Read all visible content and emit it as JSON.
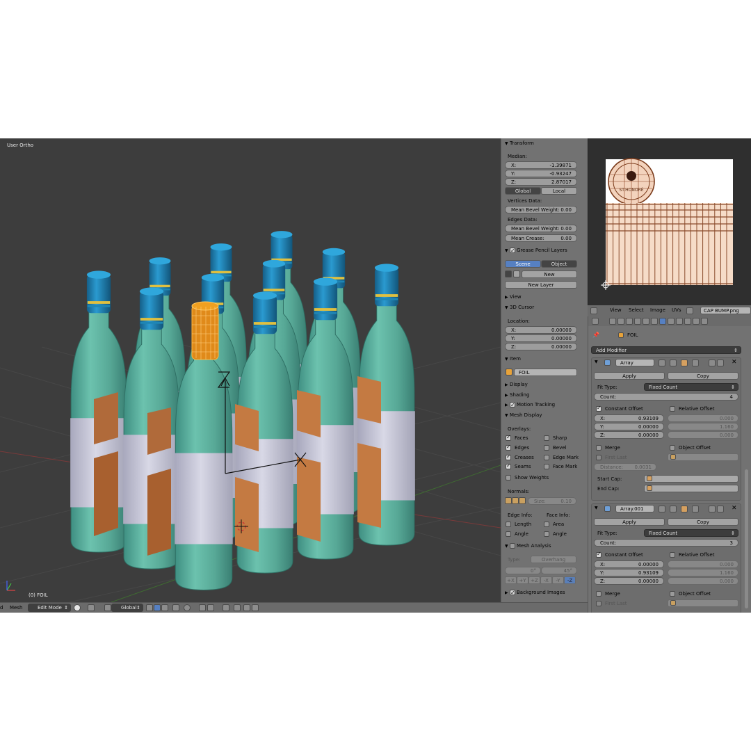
{
  "viewport": {
    "view_label": "User Ortho",
    "object_label": "(0) FOIL"
  },
  "header": {
    "view_menu": "d",
    "mesh_menu": "Mesh",
    "mode": "Edit Mode",
    "orientation": "Global"
  },
  "npanel": {
    "transform": {
      "title": "Transform",
      "median_label": "Median:",
      "x_label": "X:",
      "x_value": "-1.39871",
      "y_label": "Y:",
      "y_value": "-0.93247",
      "z_label": "Z:",
      "z_value": "2.87017",
      "global": "Global",
      "local": "Local",
      "vertices_data": "Vertices Data:",
      "edges_data": "Edges Data:",
      "mean_bevel_weight_label": "Mean Bevel Weight:",
      "mean_bevel_weight_v": "0.00",
      "mean_bevel_weight_e": "0.00",
      "mean_crease_label": "Mean Crease:",
      "mean_crease": "0.00"
    },
    "grease_pencil": {
      "title": "Grease Pencil Layers",
      "scene": "Scene",
      "object": "Object",
      "new": "New",
      "new_layer": "New Layer"
    },
    "view_title": "View",
    "cursor": {
      "title": "3D Cursor",
      "location": "Location:",
      "x_label": "X:",
      "x_value": "0.00000",
      "y_label": "Y:",
      "y_value": "0.00000",
      "z_label": "Z:",
      "z_value": "0.00000"
    },
    "item": {
      "title": "Item",
      "name": "FOIL"
    },
    "display_title": "Display",
    "shading_title": "Shading",
    "motion_tracking_title": "Motion Tracking",
    "mesh_display": {
      "title": "Mesh Display",
      "overlays": "Overlays:",
      "faces": "Faces",
      "sharp": "Sharp",
      "edges": "Edges",
      "bevel": "Bevel",
      "creases": "Creases",
      "edge_mark": "Edge Mark",
      "seams": "Seams",
      "face_mark": "Face Mark",
      "show_weights": "Show Weights",
      "normals": "Normals:",
      "size_label": "Size:",
      "size_value": "0.10",
      "edge_info": "Edge Info:",
      "face_info": "Face Info:",
      "length": "Length",
      "area": "Area",
      "angle_e": "Angle",
      "angle_f": "Angle"
    },
    "mesh_analysis": {
      "title": "Mesh Analysis",
      "type_label": "Type:",
      "type_value": "Overhang",
      "min": "0°",
      "max": "45°",
      "axes": [
        "+X",
        "+Y",
        "+Z",
        "-X",
        "-Y",
        "-Z"
      ]
    },
    "background_images_title": "Background Images"
  },
  "uv_editor": {
    "seal_text": "ST.HONORÉ",
    "menu_view": "View",
    "menu_select": "Select",
    "menu_image": "Image",
    "menu_uvs": "UVs",
    "image_name": "CAP BUMP.png"
  },
  "properties": {
    "object_name": "FOIL",
    "add_modifier": "Add Modifier",
    "modifiers": [
      {
        "name": "Array",
        "apply": "Apply",
        "copy": "Copy",
        "fit_type_label": "Fit Type:",
        "fit_type": "Fixed Count",
        "count_label": "Count:",
        "count": "4",
        "constant_offset": "Constant Offset",
        "relative_offset": "Relative Offset",
        "cx": "0.93109",
        "cy": "0.00000",
        "cz": "0.00000",
        "rx": "0.000",
        "ry": "1.160",
        "rz": "0.000",
        "merge": "Merge",
        "object_offset": "Object Offset",
        "first_last": "First Last",
        "distance_label": "Distance:",
        "distance": "0.0031",
        "start_cap": "Start Cap:",
        "end_cap": "End Cap:"
      },
      {
        "name": "Array.001",
        "apply": "Apply",
        "copy": "Copy",
        "fit_type_label": "Fit Type:",
        "fit_type": "Fixed Count",
        "count_label": "Count:",
        "count": "3",
        "constant_offset": "Constant Offset",
        "relative_offset": "Relative Offset",
        "cx": "0.00000",
        "cy": "0.93109",
        "cz": "0.00000",
        "rx": "0.000",
        "ry": "1.160",
        "rz": "0.000",
        "merge": "Merge",
        "object_offset": "Object Offset",
        "first_last": "First Last"
      }
    ],
    "axis_labels": {
      "x": "X:",
      "y": "Y:",
      "z": "Z:"
    }
  },
  "colors": {
    "bottle": "#5fb3a1",
    "cap": "#1f86b5",
    "label": "#c9c9d9",
    "divider": "#c0703c",
    "selected": "#f0a020",
    "accent": "#5680c2"
  }
}
